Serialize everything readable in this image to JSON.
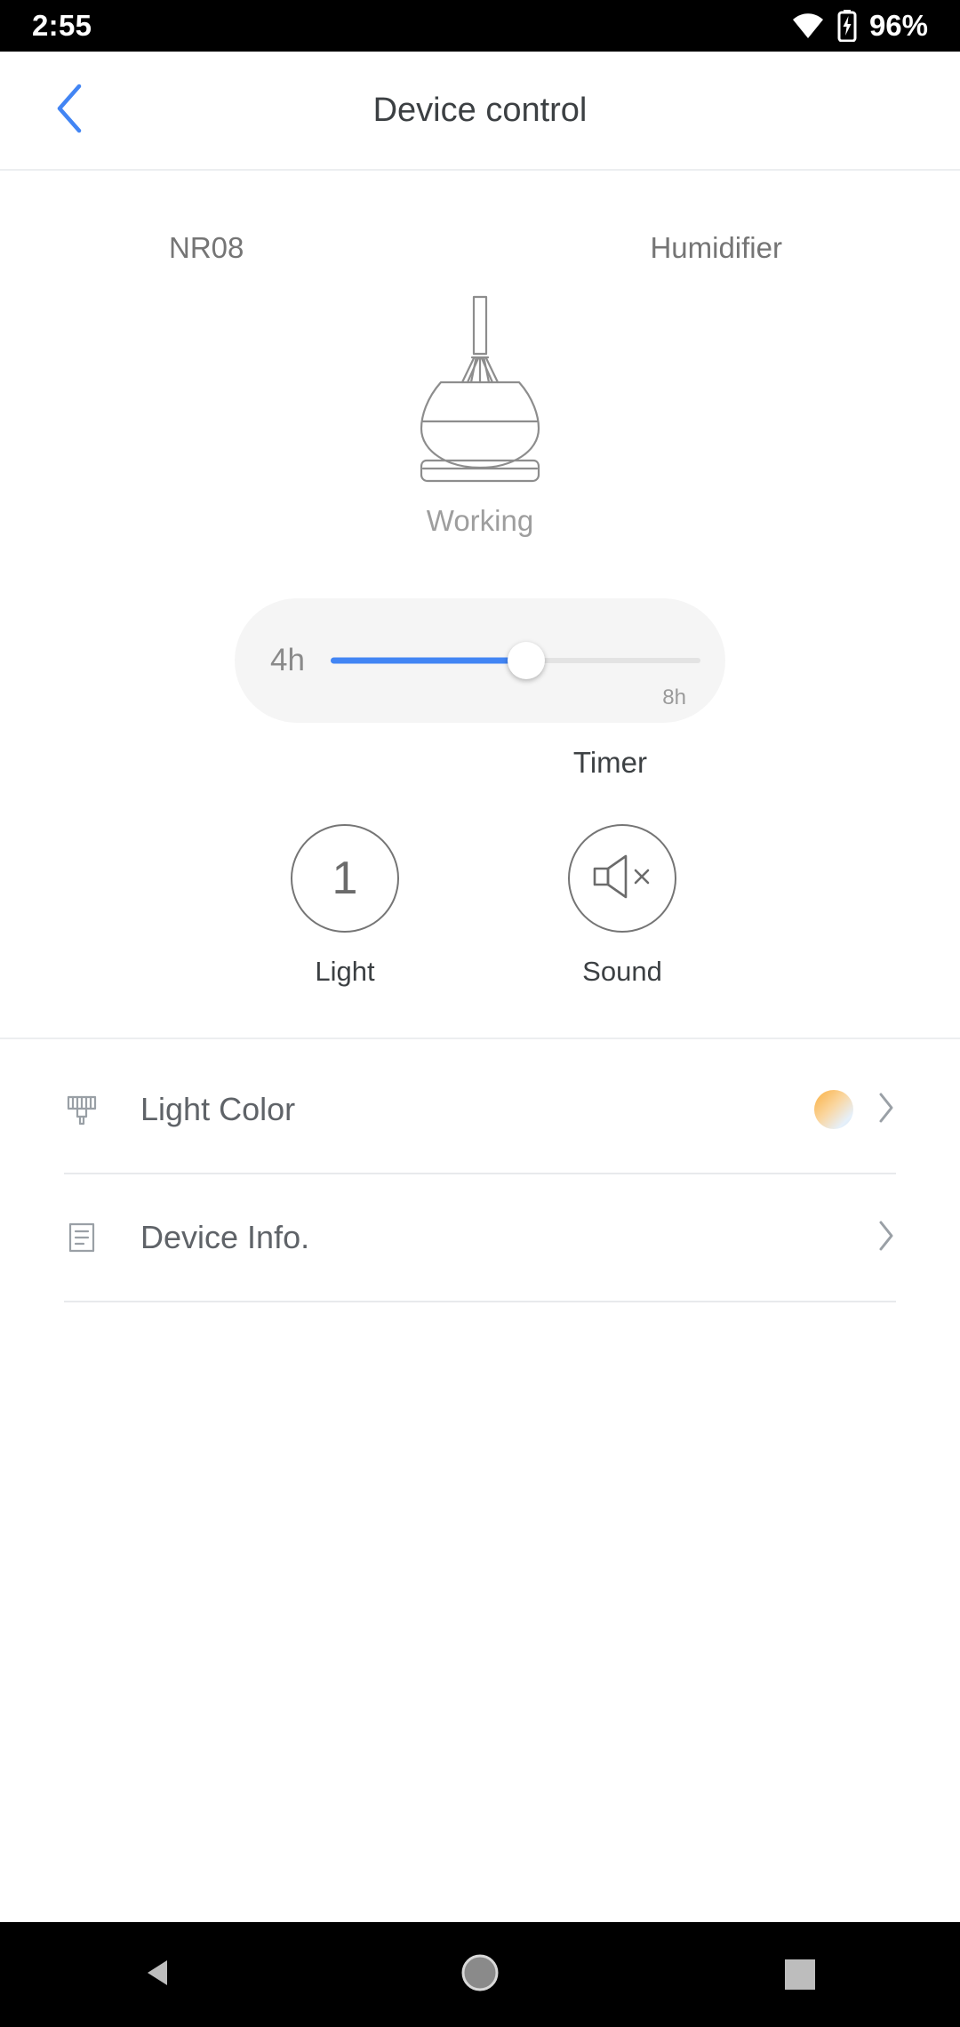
{
  "status_bar": {
    "time": "2:55",
    "battery_text": "96%",
    "wifi_icon": "wifi-icon",
    "battery_icon": "battery-charging-icon"
  },
  "app_bar": {
    "title": "Device control",
    "back_icon": "back-chevron-icon",
    "back_color": "#4285f4"
  },
  "device": {
    "model": "NR08",
    "type": "Humidifier",
    "status": "Working",
    "illustration_icon": "humidifier-icon"
  },
  "timer": {
    "value_label": "4h",
    "max_label": "8h",
    "caption": "Timer",
    "fill_percent": 53,
    "track_color": "#4285f4",
    "track_bg_color": "#e3e3e3",
    "card_bg_color": "#f5f5f5"
  },
  "controls": [
    {
      "name": "light",
      "caption": "Light",
      "value": "1",
      "icon": "light-level-icon"
    },
    {
      "name": "sound",
      "caption": "Sound",
      "value": "",
      "icon": "speaker-mute-icon"
    }
  ],
  "list": [
    {
      "label": "Light Color",
      "icon": "brush-icon",
      "accessory": "color-swatch",
      "chevron": "chevron-right-icon"
    },
    {
      "label": "Device Info.",
      "icon": "document-icon",
      "accessory": "none",
      "chevron": "chevron-right-icon"
    }
  ],
  "nav_bar": {
    "back_icon": "nav-back-triangle-icon",
    "home_icon": "nav-home-circle-icon",
    "recents_icon": "nav-recents-square-icon"
  }
}
